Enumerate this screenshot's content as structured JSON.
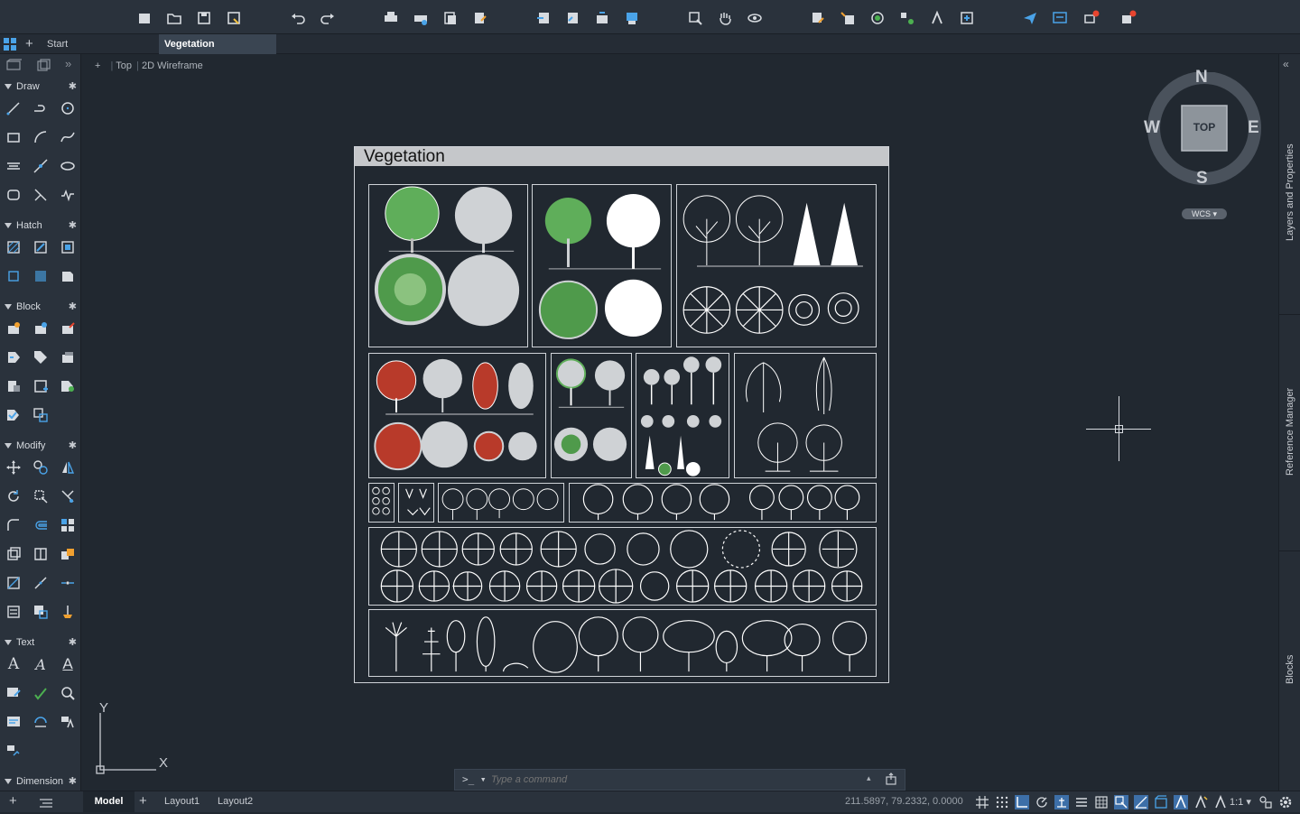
{
  "toolbar": {
    "icons": [
      "new-file-icon",
      "open-icon",
      "save-icon",
      "save-as-icon",
      "undo-icon",
      "redo-icon",
      "plot-icon",
      "batch-plot-icon",
      "publish-icon",
      "export-icon",
      "import-icon",
      "attach-icon",
      "share-icon",
      "transmit-icon",
      "zoom-window-icon",
      "pan-icon",
      "orbit-icon",
      "match-properties-icon",
      "layer-icon",
      "xref-icon",
      "blocks-palette-icon",
      "attribute-icon",
      "count-icon",
      "send-icon",
      "screen-icon",
      "notification-icon",
      "apps-icon"
    ]
  },
  "tabs": {
    "start_label": "Start",
    "active_label": "Vegetation"
  },
  "viewport_controls": {
    "minus": "+",
    "view": "Top",
    "style": "2D Wireframe"
  },
  "viewcube": {
    "n": "N",
    "s": "S",
    "e": "E",
    "w": "W",
    "face": "TOP",
    "wcs": "WCS"
  },
  "ucs": {
    "x": "X",
    "y": "Y"
  },
  "panel": {
    "sections": [
      {
        "label": "Draw"
      },
      {
        "label": "Hatch"
      },
      {
        "label": "Block"
      },
      {
        "label": "Modify"
      },
      {
        "label": "Text"
      },
      {
        "label": "Dimension"
      }
    ]
  },
  "drawing": {
    "title": "Vegetation"
  },
  "side_tabs": {
    "layers": "Layers and Properties",
    "xref": "Reference Manager",
    "blocks": "Blocks"
  },
  "command": {
    "prompt": ">_",
    "placeholder": "Type a command"
  },
  "status": {
    "model": "Model",
    "layout1": "Layout1",
    "layout2": "Layout2",
    "coords": "211.5897, 79.2332, 0.0000",
    "scale": "1:1"
  }
}
